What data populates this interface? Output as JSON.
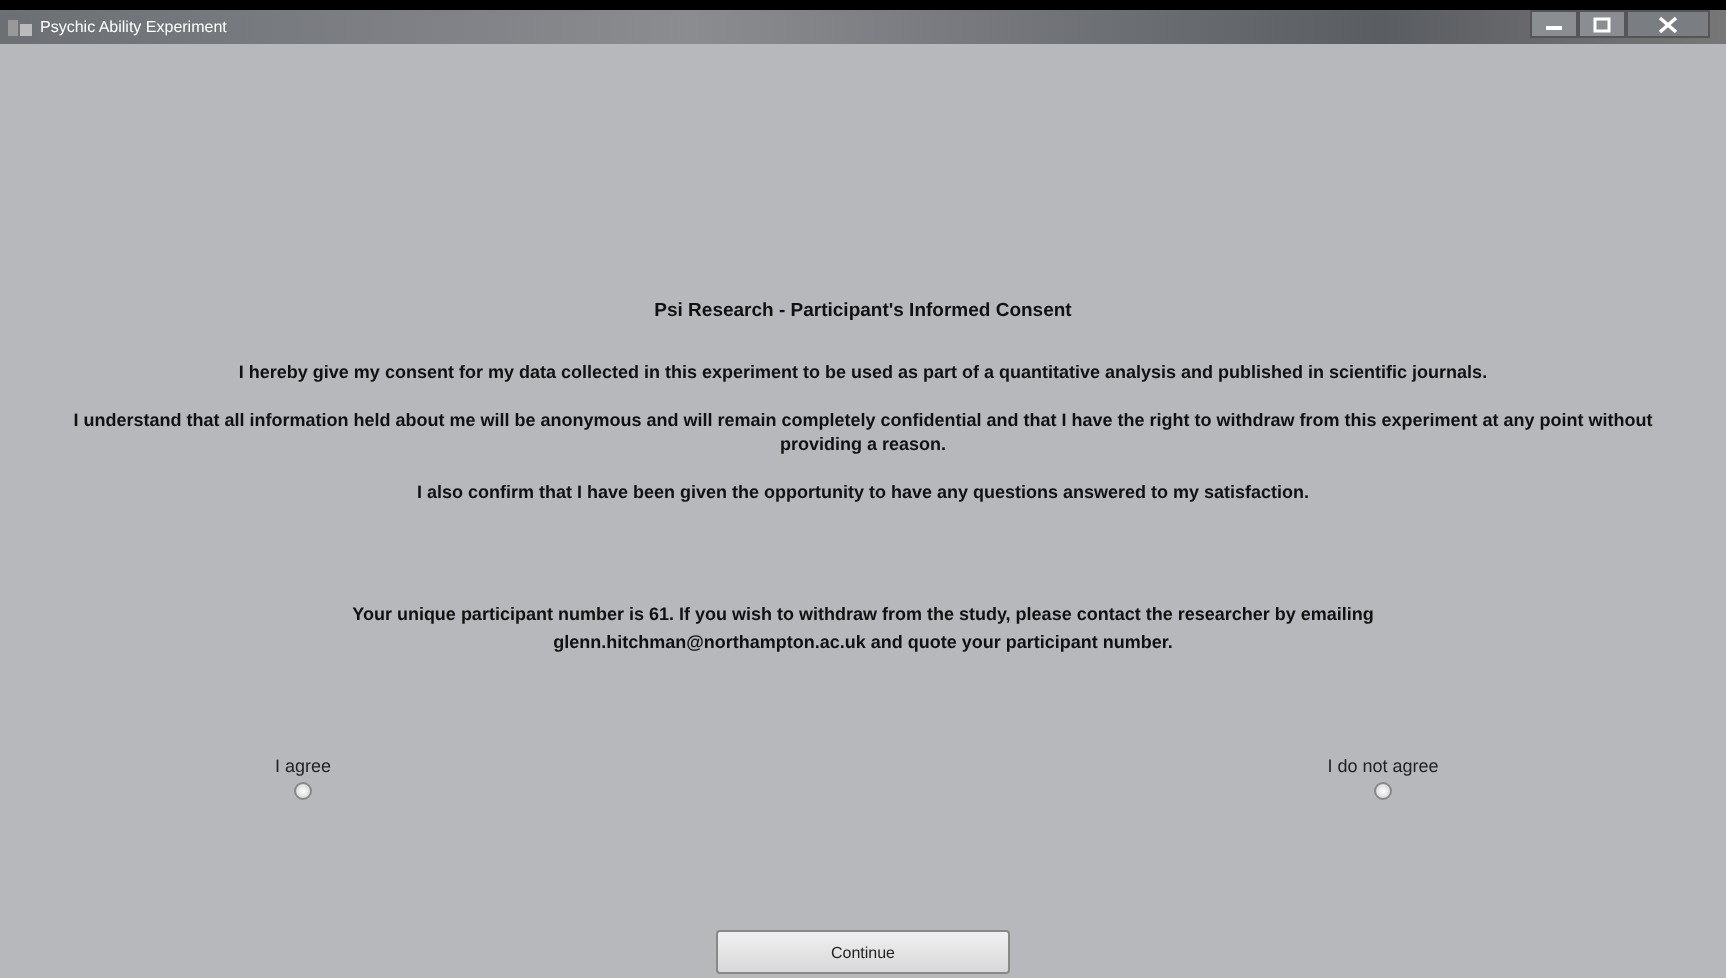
{
  "window": {
    "title": "Psychic Ability Experiment"
  },
  "heading": "Psi Research - Participant's Informed Consent",
  "paragraphs": [
    "I hereby give my consent for my data collected in this experiment to be used as part of a quantitative analysis and published in scientific journals.",
    "I understand that all information held about me will be anonymous and will remain completely confidential and that I have the right to withdraw from this experiment at any point without providing a reason.",
    "I also confirm that I have been given the opportunity to have any questions answered to my satisfaction."
  ],
  "participant_note": "Your unique participant number is 61. If you wish to withdraw from the study, please contact the researcher by emailing glenn.hitchman@northampton.ac.uk and quote your participant number.",
  "options": [
    {
      "label": "I agree",
      "selected": false
    },
    {
      "label": "I do not agree",
      "selected": false
    }
  ],
  "continue_button": "Continue"
}
